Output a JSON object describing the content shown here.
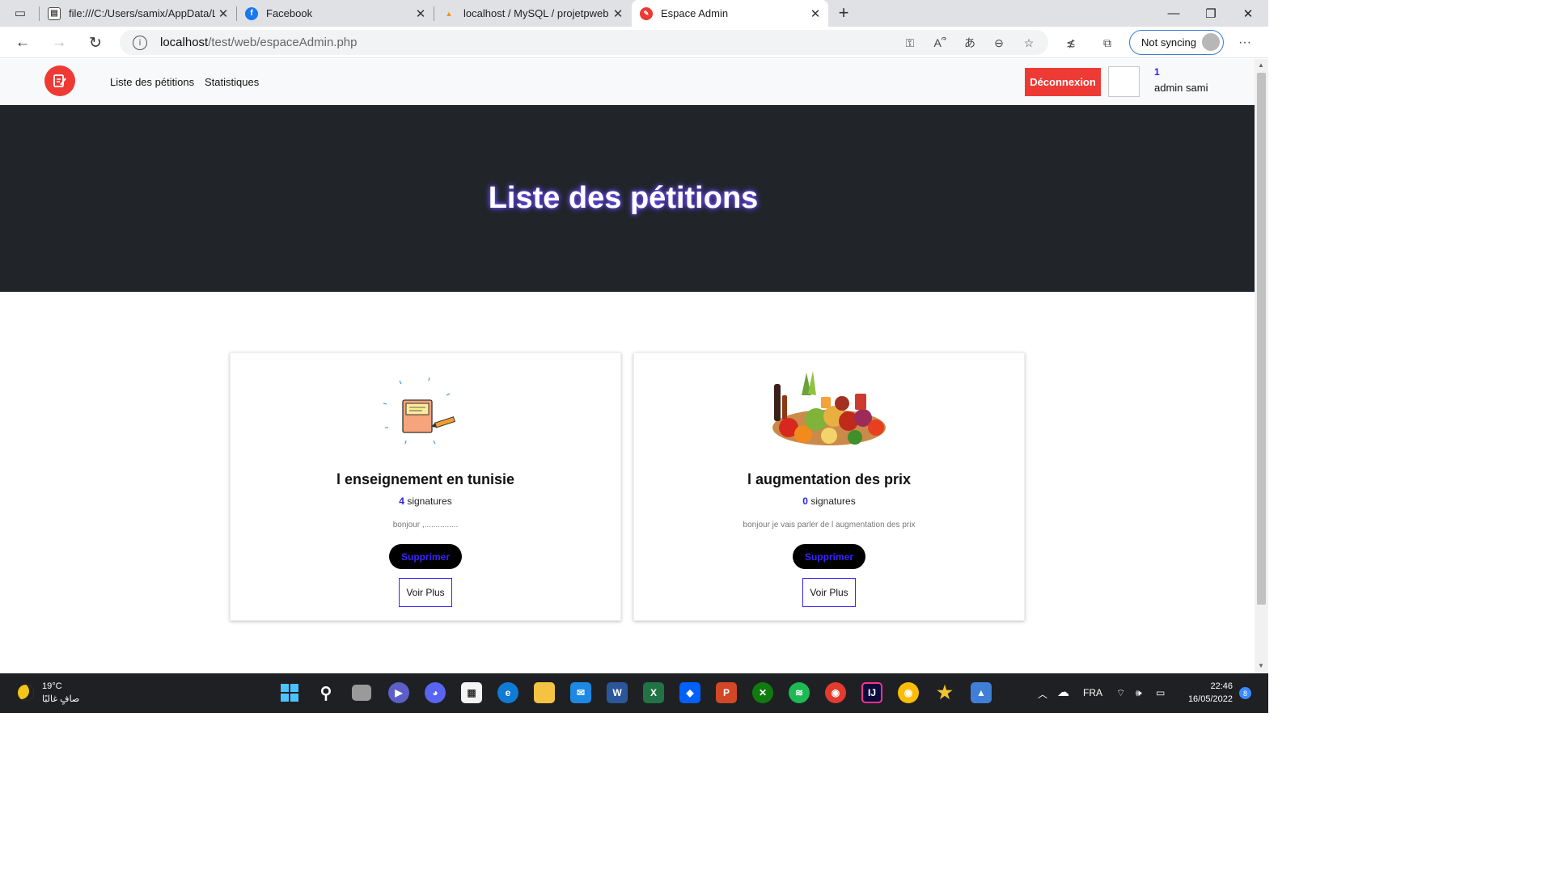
{
  "browser": {
    "tabs": [
      {
        "title": "file:///C:/Users/samix/AppData/L",
        "icon": "file-pdf-icon"
      },
      {
        "title": "Facebook",
        "icon": "facebook-icon"
      },
      {
        "title": "localhost / MySQL / projetpweb",
        "icon": "phpmyadmin-icon"
      },
      {
        "title": "Espace Admin",
        "icon": "site-icon"
      }
    ],
    "url_host": "localhost",
    "url_path": "/test/web/espaceAdmin.php",
    "sync_label": "Not syncing"
  },
  "nav": {
    "links": [
      "Liste des pétitions",
      "Statistiques"
    ],
    "logout_label": "Déconnexion",
    "user_id": "1",
    "user_name": "admin sami"
  },
  "hero": {
    "title": "Liste des pétitions"
  },
  "petitions": [
    {
      "title": "l enseignement en tunisie",
      "signatures": "4",
      "signatures_label": "signatures",
      "description": "bonjour ,...............",
      "delete_label": "Supprimer",
      "more_label": "Voir Plus",
      "image": "notebook-pencil-illustration"
    },
    {
      "title": "l augmentation des prix",
      "signatures": "0",
      "signatures_label": "signatures",
      "description": "bonjour je vais parler de l augmentation des prix",
      "delete_label": "Supprimer",
      "more_label": "Voir Plus",
      "image": "groceries-photo"
    }
  ],
  "taskbar": {
    "temperature": "19°C",
    "weather_text": "صافٍ غالبًا",
    "language": "FRA",
    "time": "22:46",
    "date": "16/05/2022",
    "notifications": "8"
  },
  "colors": {
    "accent_red": "#ee3a34",
    "link_blue": "#2a1ee6",
    "hero_bg": "#212529"
  }
}
